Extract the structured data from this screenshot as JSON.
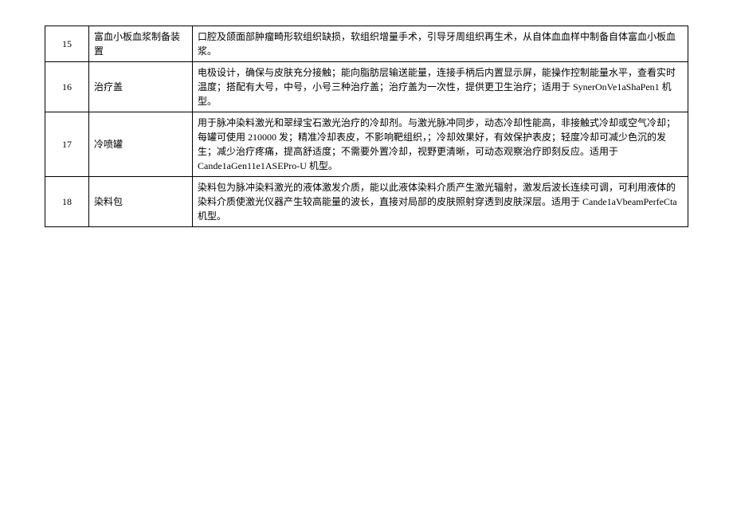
{
  "table": {
    "rows": [
      {
        "num": "15",
        "name": "富血小板血浆制备装置",
        "desc": "口腔及颌面部肿瘤畸形软组织缺损，软组织增量手术，引导牙周组织再生术，从自体血血样中制备自体富血小板血浆。"
      },
      {
        "num": "16",
        "name": "治疗盖",
        "desc": "电极设计，确保与皮肤充分接触；能向脂肪层输送能量，连接手柄后内置显示屏，能操作控制能量水平，查看实时温度；搭配有大号，中号，小号三种治疗盖；治疗盖为一次性，提供更卫生治疗；适用于 SynerOnVe1aShaPen1 机型。"
      },
      {
        "num": "17",
        "name": "冷喷罐",
        "desc": "用于脉冲染料激光和翠绿宝石激光治疗的冷却剂。与激光脉冲同步，动态冷却性能高，非接触式冷却或空气冷却；每罐可使用 210000 发；精准冷却表皮，不影响靶组织，；冷却效果好，有效保护表皮；轻度冷却可减少色沉的发生；减少治疗疼痛，提高舒适度；不需要外置冷却，视野更清晰，可动态观察治疗即刻反应。适用于 Cande1aGen11e1ASEPro-U 机型。"
      },
      {
        "num": "18",
        "name": "染料包",
        "desc": "染料包为脉冲染料激光的液体激发介质，能以此液体染料介质产生激光辐射，激发后波长连续可调，可利用液体的染料介质使激光仪器产生较高能量的波长，直接对局部的皮肤照射穿透到皮肤深层。适用于 Cande1aVbeamPerfeCta 机型。"
      }
    ]
  }
}
